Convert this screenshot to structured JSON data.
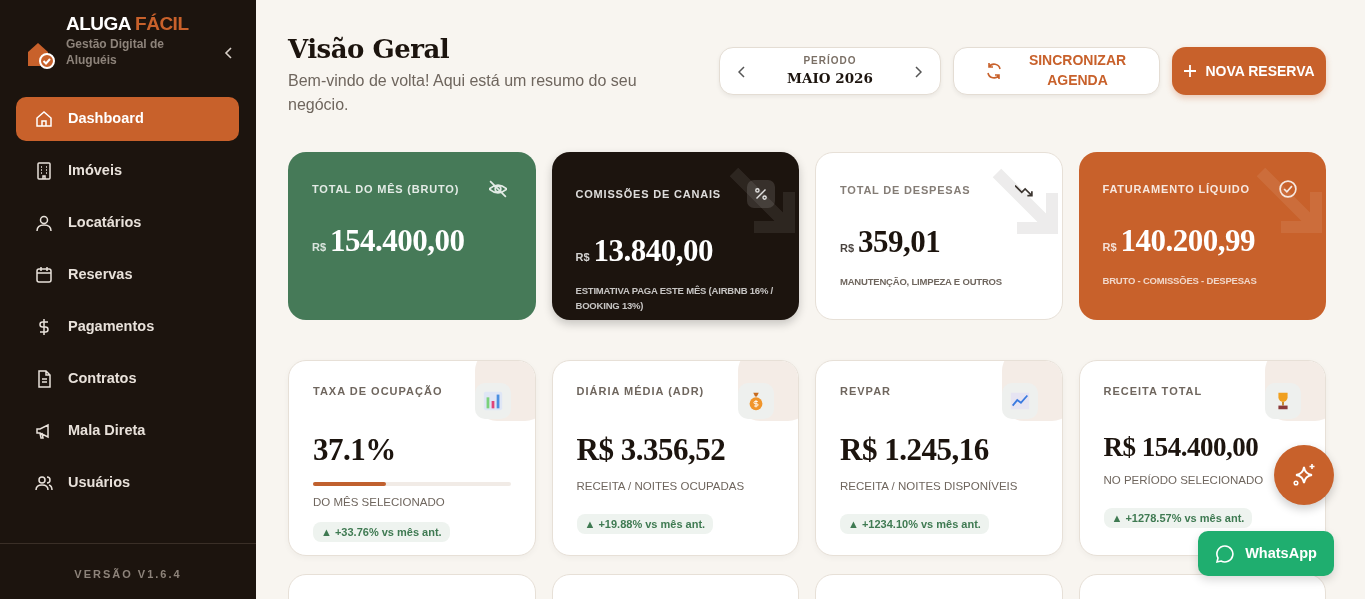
{
  "sidebar": {
    "brand": {
      "name": "ALUGA",
      "name_accent": "FÁCIL",
      "tagline": "Gestão Digital de Aluguéis"
    },
    "items": [
      {
        "label": "Dashboard",
        "selected": true
      },
      {
        "label": "Imóveis",
        "selected": false
      },
      {
        "label": "Locatários",
        "selected": false
      },
      {
        "label": "Reservas",
        "selected": false
      },
      {
        "label": "Pagamentos",
        "selected": false
      },
      {
        "label": "Contratos",
        "selected": false
      },
      {
        "label": "Mala Direta",
        "selected": false
      },
      {
        "label": "Usuários",
        "selected": false
      }
    ],
    "version": "VERSÃO V1.6.4"
  },
  "header": {
    "title": "Visão Geral",
    "subtitle": "Bem-vindo de volta! Aqui está um resumo do seu negócio.",
    "period": {
      "label": "PERÍODO",
      "value": "MAIO 2026"
    },
    "sync_button": "SINCRONIZAR AGENDA",
    "new_button": "NOVA RESERVA"
  },
  "summary_cards": [
    {
      "kind": "green",
      "label": "TOTAL DO MÊS (BRUTO)",
      "currency": "R$",
      "amount": "154.400,00"
    },
    {
      "kind": "dark",
      "label": "COMISSÕES DE CANAIS",
      "currency": "R$",
      "amount": "13.840,00",
      "note": "ESTIMATIVA PAGA ESTE MÊS (AIRBNB 16% / BOOKING 13%)"
    },
    {
      "kind": "light",
      "label": "TOTAL DE DESPESAS",
      "currency": "R$",
      "amount": "359,01",
      "note": "MANUTENÇÃO, LIMPEZA E OUTROS"
    },
    {
      "kind": "accent",
      "label": "FATURAMENTO LÍQUIDO",
      "currency": "R$",
      "amount": "140.200,99",
      "note": "BRUTO - COMISSÕES - DESPESAS"
    }
  ],
  "metric_cards": [
    {
      "label": "TAXA DE OCUPAÇÃO",
      "value": "37.1%",
      "level": 0.371,
      "note": "DO MÊS SELECIONADO",
      "change": "▲ +33.76% vs mês ant."
    },
    {
      "label": "DIÁRIA MÉDIA (ADR)",
      "value": "R$ 3.356,52",
      "note": "RECEITA / NOITES OCUPADAS",
      "change": "▲ +19.88% vs mês ant."
    },
    {
      "label": "REVPAR",
      "value": "R$ 1.245,16",
      "note": "RECEITA / NOITES DISPONÍVEIS",
      "change": "▲ +1234.10% vs mês ant."
    },
    {
      "label": "RECEITA TOTAL",
      "value": "R$ 154.400,00",
      "note": "NO PERÍODO SELECIONADO",
      "change": "▲ +1278.57% vs mês ant."
    }
  ],
  "whatsapp_button": "WhatsApp"
}
